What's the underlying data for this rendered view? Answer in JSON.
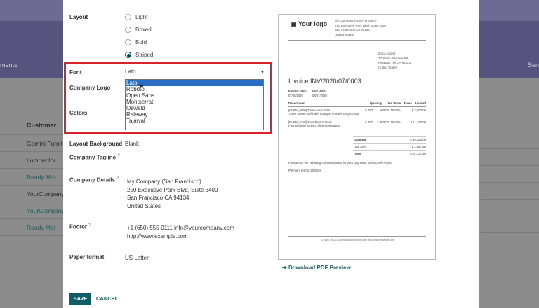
{
  "background": {
    "left_text": "ments",
    "right_text": "Sen",
    "table": {
      "header": "Customer",
      "rows": [
        {
          "text": "Gemini Furnit",
          "link": false
        },
        {
          "text": "Lumber Inc",
          "link": false
        },
        {
          "text": "Ready Mat",
          "link": true
        },
        {
          "text": "YourCompany",
          "link": false
        },
        {
          "text": "YourCompany",
          "link": true
        },
        {
          "text": "Ready Mat",
          "link": true
        }
      ]
    }
  },
  "form": {
    "layout_label": "Layout",
    "layout_options": [
      {
        "label": "Light",
        "checked": false
      },
      {
        "label": "Boxed",
        "checked": false
      },
      {
        "label": "Bold",
        "checked": false
      },
      {
        "label": "Striped",
        "checked": true
      }
    ],
    "font_label": "Font",
    "font_value": "Lato",
    "font_options": [
      "Lato",
      "Roboto",
      "Open Sans",
      "Montserrat",
      "Oswald",
      "Raleway",
      "Tajawal"
    ],
    "font_selected_index": 0,
    "company_logo_label": "Company Logo",
    "colors_label": "Colors",
    "layout_background_label": "Layout Background",
    "layout_background_value": "Blank",
    "company_tagline_label": "Company Tagline",
    "tooltip_mark": "?",
    "company_details_label": "Company Details",
    "company_details_lines": [
      "My Company (San Francisco)",
      "250 Executive Park Blvd, Suite 3400",
      "San Francisco CA 94134",
      "United States"
    ],
    "footer_label": "Footer",
    "footer_lines": [
      "+1 (650) 555-0111 info@yourcompany.com",
      "http://www.example.com"
    ],
    "paper_format_label": "Paper format",
    "paper_format_value": "US Letter"
  },
  "preview": {
    "logo": "Your logo",
    "company_lines": [
      "My Company (San Francisco)",
      "250 Executive Park Blvd, Suite 3400",
      "San Francisco CA 94134",
      "United States"
    ],
    "customer_lines": [
      "Deco Addict",
      "77 Santa Barbara Rd",
      "Pleasant Hill CA 94523",
      "United States"
    ],
    "invoice_title": "Invoice INV/2020/07/0003",
    "invoice_date_label": "Invoice Date:",
    "due_date_label": "Due Date:",
    "invoice_date": "07/08/2020",
    "due_date": "08/07/2020",
    "columns": {
      "description": "Description",
      "quantity": "Quantity",
      "unit_price": "Unit Price",
      "taxes": "Taxes",
      "amount": "Amount"
    },
    "lines": [
      {
        "desc1": "[FURN_8999] Three-Seat Sofa",
        "desc2": "Three Seater Sofa with Lounger in Steel Grey Colour",
        "qty": "5.000",
        "price": "1,500.00",
        "taxes": "15.00%",
        "amount": "$ 7,500.00"
      },
      {
        "desc1": "[FURN_8220] Four Person Desk",
        "desc2": "Four person modern office workstation",
        "qty": "5.000",
        "price": "2,350.00",
        "taxes": "15.00%",
        "amount": "$ 11,750.00"
      }
    ],
    "subtotal_label": "Subtotal",
    "subtotal": "$ 19,250.00",
    "tax_label": "Tax 15%",
    "tax": "$ 2,887.50",
    "total_label": "Total",
    "total": "$ 22,137.50",
    "payment_note": "Please use the following communication for your payment : INV/2020/07/0003",
    "payment_terms": "Payment terms: 30 Days",
    "footer": "+1 (650) 555-0111 info@yourcompany.com http://www.example.com"
  },
  "download_label": "Download PDF Preview",
  "buttons": {
    "save": "SAVE",
    "cancel": "CANCEL"
  }
}
